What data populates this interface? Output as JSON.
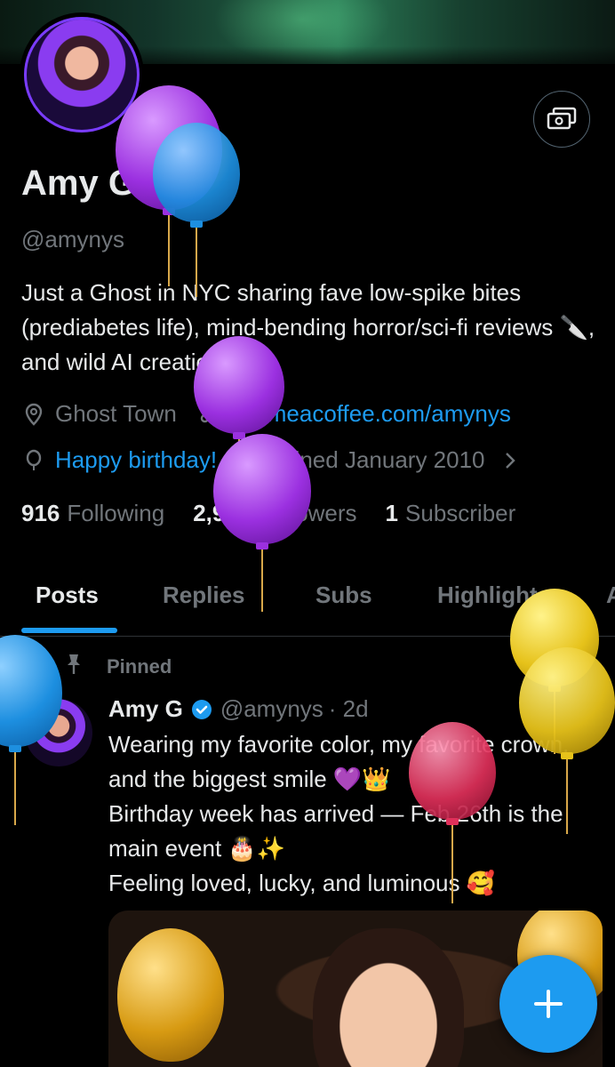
{
  "profile": {
    "name": "Amy G",
    "handle": "@amynys",
    "bio": "Just a Ghost in NYC sharing fave low-spike bites (prediabetes life), mind-bending horror/sci-fi reviews 🔪, and wild AI creations.",
    "location": "Ghost Town",
    "website": "buymeacoffee.com/amynys",
    "birthday": "Happy birthday!",
    "joined": "Joined January 2010"
  },
  "stats": {
    "following_count": "916",
    "following_label": "Following",
    "followers_count": "2,938",
    "followers_label": "Followers",
    "subscriber_count": "1",
    "subscriber_label": "Subscriber"
  },
  "tabs": [
    "Posts",
    "Replies",
    "Subs",
    "Highlights",
    "A"
  ],
  "post": {
    "pinned_label": "Pinned",
    "author": "Amy G",
    "handle": "@amynys",
    "time": "· 2d",
    "text": "Wearing my favorite color, my favorite crown, and the biggest smile 💜👑\nBirthday week has arrived — Feb 26th is the main event 🎂✨\nFeeling loved, lucky, and luminous 🥰"
  },
  "colors": {
    "accent": "#1d9bf0",
    "text_primary": "#e7e9ea",
    "text_secondary": "#71767b",
    "balloon_purple": "#9b30e0",
    "balloon_blue": "#1d8fe0",
    "balloon_yellow": "#e6c21a",
    "balloon_pink": "#e0305a"
  },
  "icons": {
    "location": "location-pin-icon",
    "link": "link-icon",
    "birthday": "balloon-icon",
    "calendar": "calendar-icon",
    "pin": "pin-icon",
    "verified": "verified-badge-icon",
    "tip": "money-icon",
    "compose": "plus-icon"
  }
}
